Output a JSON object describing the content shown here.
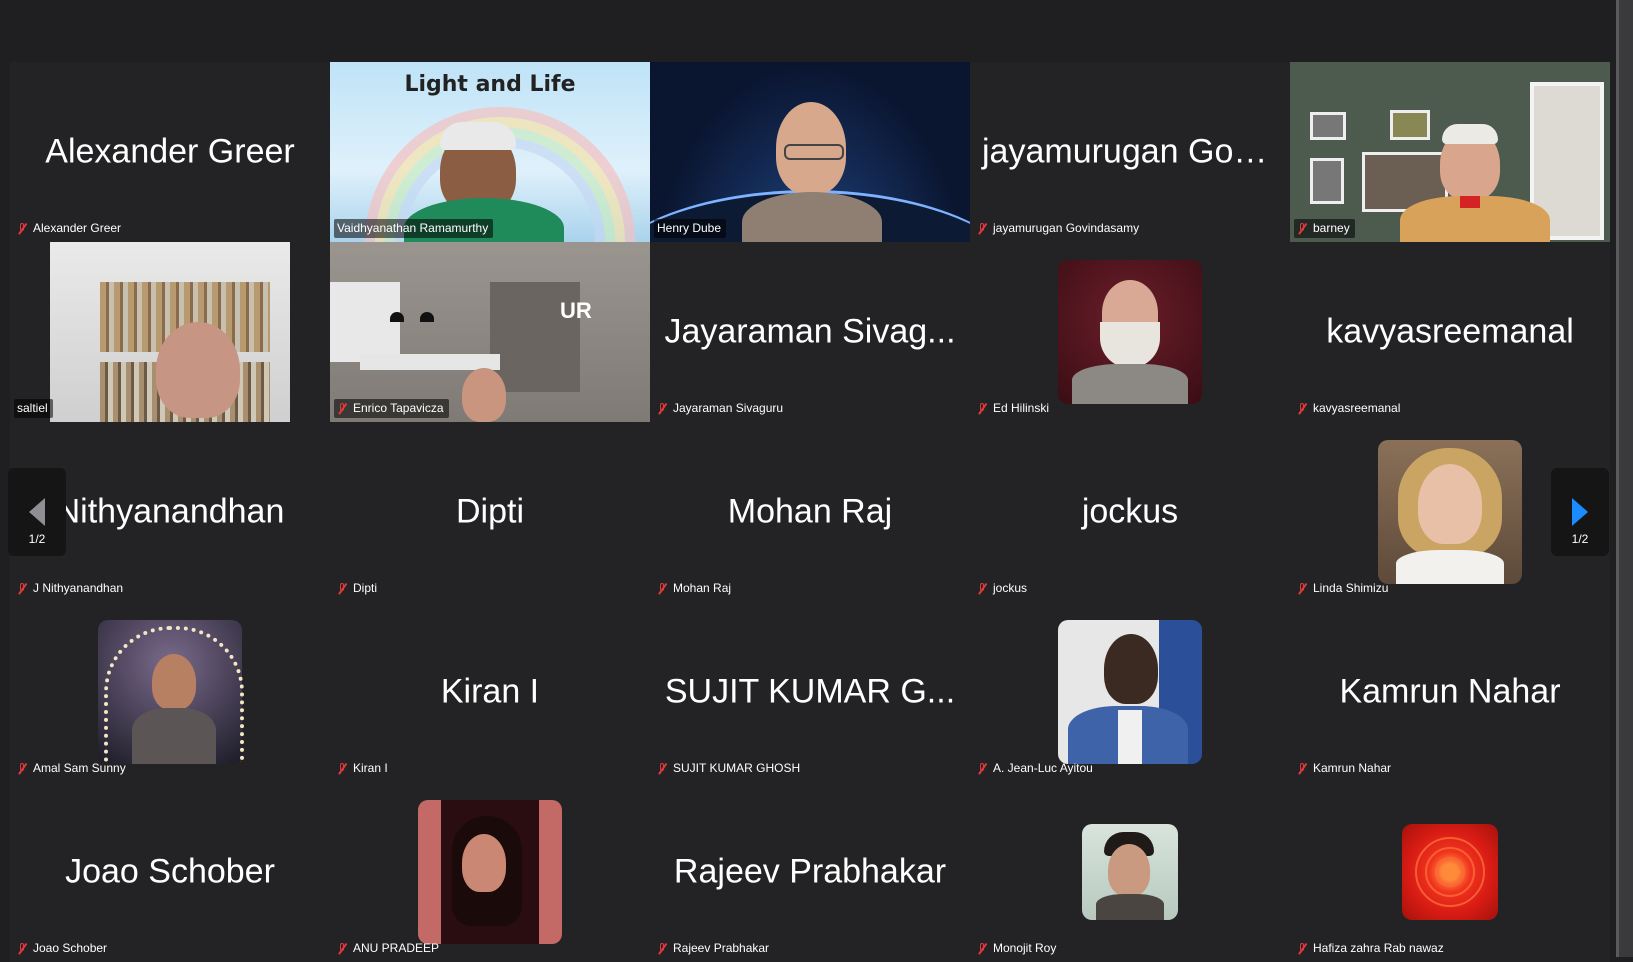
{
  "pager": {
    "prev_page": "1/2",
    "next_page": "1/2"
  },
  "virtual_background_text": "Light and Life",
  "room_logo_text": "UR",
  "colors": {
    "active_speaker": "#3bd65b",
    "muted_mic": "#e23a3a",
    "next_arrow": "#1a8cff"
  },
  "tiles": [
    {
      "display": "Alexander Greer",
      "tag": "Alexander Greer"
    },
    {
      "display": "",
      "tag": "Vaidhyanathan Ramamurthy"
    },
    {
      "display": "",
      "tag": "Henry Dube"
    },
    {
      "display": "jayamurugan Govi...",
      "tag": "jayamurugan Govindasamy"
    },
    {
      "display": "",
      "tag": "barney"
    },
    {
      "display": "",
      "tag": "saltiel"
    },
    {
      "display": "",
      "tag": "Enrico Tapavicza"
    },
    {
      "display": "Jayaraman Sivag...",
      "tag": "Jayaraman Sivaguru"
    },
    {
      "display": "",
      "tag": "Ed Hilinski"
    },
    {
      "display": "kavyasreemanal",
      "tag": "kavyasreemanal"
    },
    {
      "display": "Nithyanandhan",
      "tag": "J Nithyanandhan"
    },
    {
      "display": "Dipti",
      "tag": "Dipti"
    },
    {
      "display": "Mohan Raj",
      "tag": "Mohan Raj"
    },
    {
      "display": "jockus",
      "tag": "jockus"
    },
    {
      "display": "",
      "tag": "Linda Shimizu"
    },
    {
      "display": "",
      "tag": "Amal Sam Sunny"
    },
    {
      "display": "Kiran I",
      "tag": "Kiran I"
    },
    {
      "display": "SUJIT KUMAR G...",
      "tag": "SUJIT KUMAR GHOSH"
    },
    {
      "display": "",
      "tag": "A. Jean-Luc Ayitou"
    },
    {
      "display": "Kamrun Nahar",
      "tag": "Kamrun Nahar"
    },
    {
      "display": "Joao Schober",
      "tag": "Joao Schober"
    },
    {
      "display": "",
      "tag": "ANU PRADEEP"
    },
    {
      "display": "Rajeev Prabhakar",
      "tag": "Rajeev Prabhakar"
    },
    {
      "display": "",
      "tag": "Monojit Roy"
    },
    {
      "display": "",
      "tag": "Hafiza zahra Rab nawaz"
    }
  ]
}
